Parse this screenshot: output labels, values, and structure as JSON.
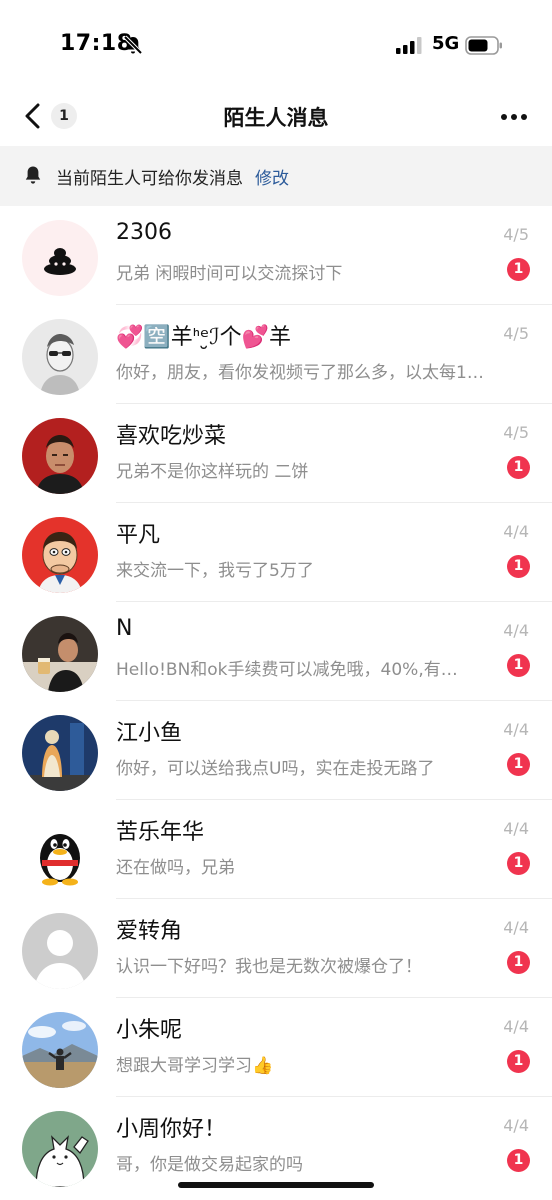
{
  "status_bar": {
    "time": "17:18",
    "network": "5G",
    "icons": [
      "bell-mute-icon",
      "signal-icon",
      "battery-icon"
    ]
  },
  "nav": {
    "back_count": "1",
    "title": "陌生人消息",
    "icons": [
      "back-chevron-icon",
      "more-dots-icon"
    ]
  },
  "notice": {
    "text": "当前陌生人可给你发消息",
    "link": "修改"
  },
  "messages": [
    {
      "name": "2306",
      "preview": "兄弟 闲暇时间可以交流探讨下",
      "date": "4/5",
      "unread": "1",
      "avatar": "poop-logo"
    },
    {
      "name": "💞🈳羊ᑋᵉ̮ℐ个💕羊",
      "preview": "你好，朋友，看你发视频亏了那么多，以太每1…",
      "date": "4/5",
      "unread": "",
      "avatar": "sketch-man-sunglasses"
    },
    {
      "name": "喜欢吃炒菜",
      "preview": "兄弟不是你这样玩的 二饼",
      "date": "4/5",
      "unread": "1",
      "avatar": "man-red-background"
    },
    {
      "name": "平凡",
      "preview": "来交流一下，我亏了5万了",
      "date": "4/4",
      "unread": "1",
      "avatar": "cartoon-man-red"
    },
    {
      "name": "N",
      "preview": "Hello!BN和ok手续费可以减免哦，40%,有…",
      "date": "4/4",
      "unread": "1",
      "avatar": "man-toasting"
    },
    {
      "name": "江小鱼",
      "preview": "你好，可以送给我点U吗，实在走投无路了",
      "date": "4/4",
      "unread": "1",
      "avatar": "statue-blue"
    },
    {
      "name": "苦乐年华",
      "preview": "还在做吗，兄弟",
      "date": "4/4",
      "unread": "1",
      "avatar": "penguin"
    },
    {
      "name": "爱转角",
      "preview": "认识一下好吗？我也是无数次被爆仓了！",
      "date": "4/4",
      "unread": "1",
      "avatar": "default-user"
    },
    {
      "name": "小朱呢",
      "preview": "想跟大哥学习学习👍",
      "date": "4/4",
      "unread": "1",
      "avatar": "person-landscape"
    },
    {
      "name": "小周你好！",
      "preview": "哥，你是做交易起家的吗",
      "date": "4/4",
      "unread": "1",
      "avatar": "cartoon-cat-green"
    }
  ],
  "colors": {
    "badge": "#f0344f",
    "link": "#2c5b9a",
    "notice_bg": "#f3f3f3",
    "preview_text": "#8e8e8e",
    "date_text": "#b6b6b6"
  }
}
